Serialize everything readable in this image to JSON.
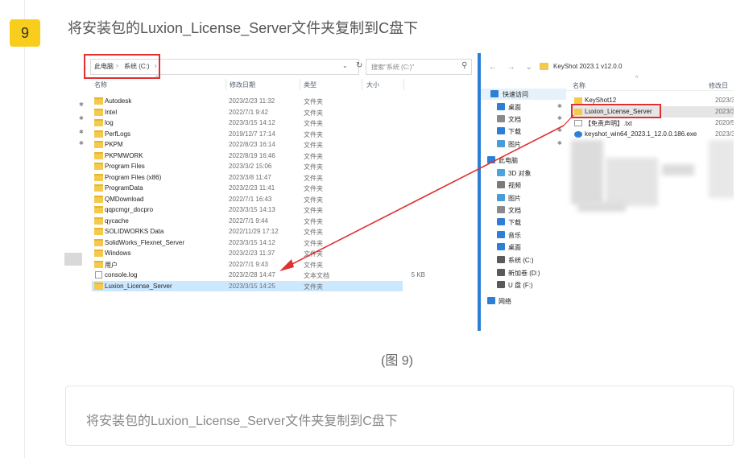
{
  "step": {
    "number": "9",
    "title": "将安装包的Luxion_License_Server文件夹复制到C盘下"
  },
  "left_explorer": {
    "breadcrumb": [
      "此电脑",
      "系统 (C:)"
    ],
    "search_placeholder": "搜索\"系统 (C:)\"",
    "columns": {
      "name": "名称",
      "date": "修改日期",
      "type": "类型",
      "size": "大小"
    },
    "files": [
      {
        "name": "Autodesk",
        "date": "2023/2/23 11:32",
        "type": "文件夹",
        "size": "",
        "icon": "folder"
      },
      {
        "name": "Intel",
        "date": "2022/7/1 9:42",
        "type": "文件夹",
        "size": "",
        "icon": "folder"
      },
      {
        "name": "log",
        "date": "2023/3/15 14:12",
        "type": "文件夹",
        "size": "",
        "icon": "folder"
      },
      {
        "name": "PerfLogs",
        "date": "2019/12/7 17:14",
        "type": "文件夹",
        "size": "",
        "icon": "folder"
      },
      {
        "name": "PKPM",
        "date": "2022/8/23 16:14",
        "type": "文件夹",
        "size": "",
        "icon": "folder"
      },
      {
        "name": "PKPMWORK",
        "date": "2022/8/19 16:46",
        "type": "文件夹",
        "size": "",
        "icon": "folder"
      },
      {
        "name": "Program Files",
        "date": "2023/3/2 15:06",
        "type": "文件夹",
        "size": "",
        "icon": "folder"
      },
      {
        "name": "Program Files (x86)",
        "date": "2023/3/8 11:47",
        "type": "文件夹",
        "size": "",
        "icon": "folder"
      },
      {
        "name": "ProgramData",
        "date": "2023/2/23 11:41",
        "type": "文件夹",
        "size": "",
        "icon": "folder"
      },
      {
        "name": "QMDownload",
        "date": "2022/7/1 16:43",
        "type": "文件夹",
        "size": "",
        "icon": "folder"
      },
      {
        "name": "qqpcmgr_docpro",
        "date": "2023/3/15 14:13",
        "type": "文件夹",
        "size": "",
        "icon": "folder"
      },
      {
        "name": "qycache",
        "date": "2022/7/1 9:44",
        "type": "文件夹",
        "size": "",
        "icon": "folder"
      },
      {
        "name": "SOLIDWORKS Data",
        "date": "2022/11/29 17:12",
        "type": "文件夹",
        "size": "",
        "icon": "folder"
      },
      {
        "name": "SolidWorks_Flexnet_Server",
        "date": "2023/3/15 14:12",
        "type": "文件夹",
        "size": "",
        "icon": "folder"
      },
      {
        "name": "Windows",
        "date": "2023/2/23 11:37",
        "type": "文件夹",
        "size": "",
        "icon": "folder"
      },
      {
        "name": "用户",
        "date": "2022/7/1 9:43",
        "type": "文件夹",
        "size": "",
        "icon": "folder"
      },
      {
        "name": "console.log",
        "date": "2023/2/28 14:47",
        "type": "文本文档",
        "size": "5 KB",
        "icon": "file"
      },
      {
        "name": "Luxion_License_Server",
        "date": "2023/3/15 14:25",
        "type": "文件夹",
        "size": "",
        "icon": "folder"
      }
    ]
  },
  "right_explorer": {
    "path": "KeyShot 2023.1 v12.0.0",
    "columns": {
      "name": "名称",
      "date": "修改日"
    },
    "nav": [
      "快速访问",
      "桌面",
      "文档",
      "下载",
      "图片",
      "此电脑",
      "3D 对象",
      "视频",
      "图片",
      "文档",
      "下载",
      "音乐",
      "桌面",
      "系统 (C:)",
      "新加卷 (D:)",
      "U 盘 (F:)",
      "网络"
    ],
    "files": [
      {
        "name": "KeyShot12",
        "date": "2023/3/"
      },
      {
        "name": "Luxion_License_Server",
        "date": "2023/3/"
      },
      {
        "name": "【免责声明】.txt",
        "date": "2020/5/"
      },
      {
        "name": "keyshot_win64_2023.1_12.0.0.186.exe",
        "date": "2023/3/"
      }
    ]
  },
  "caption": "(图 9)",
  "note": "将安装包的Luxion_License_Server文件夹复制到C盘下",
  "colors": {
    "badge": "#f9cd1b",
    "highlight": "#e12f2f",
    "selection": "#cce8ff",
    "folder": "#f5c94b"
  }
}
